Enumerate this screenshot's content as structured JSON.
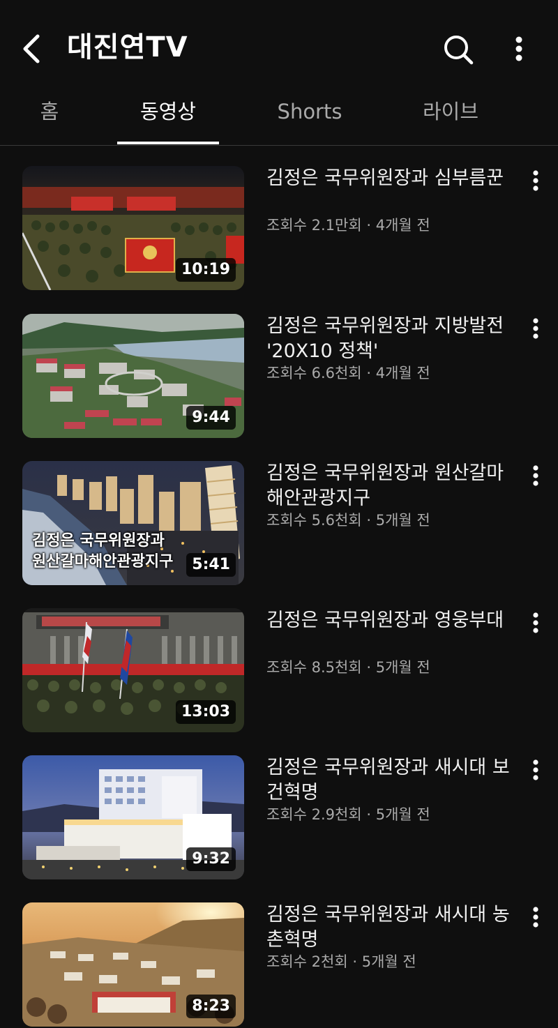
{
  "header": {
    "title": "대진연TV",
    "back_icon": "back-arrow-icon",
    "search_icon": "search-icon",
    "more_icon": "more-vert-icon"
  },
  "tabs": [
    {
      "label": "홈",
      "active": false
    },
    {
      "label": "동영상",
      "active": true
    },
    {
      "label": "Shorts",
      "active": false
    },
    {
      "label": "라이브",
      "active": false
    }
  ],
  "videos": [
    {
      "title": "김정은 국무위원장과 심부름꾼",
      "views": "조회수 2.1만회",
      "age": "4개월 전",
      "duration": "10:19",
      "meta_sep": "·"
    },
    {
      "title": "김정은 국무위원장과 지방발전 '20X10 정책'",
      "views": "조회수 6.6천회",
      "age": "4개월 전",
      "duration": "9:44",
      "meta_sep": "·"
    },
    {
      "title": "김정은 국무위원장과 원산갈마해안관광지구",
      "views": "조회수 5.6천회",
      "age": "5개월 전",
      "duration": "5:41",
      "meta_sep": "·",
      "thumb_caption_1": "김정은 국무위원장과",
      "thumb_caption_2": "원산갈마해안관광지구"
    },
    {
      "title": "김정은 국무위원장과 영웅부대",
      "views": "조회수 8.5천회",
      "age": "5개월 전",
      "duration": "13:03",
      "meta_sep": "·"
    },
    {
      "title": "김정은 국무위원장과 새시대 보건혁명",
      "views": "조회수 2.9천회",
      "age": "5개월 전",
      "duration": "9:32",
      "meta_sep": "·"
    },
    {
      "title": "김정은 국무위원장과 새시대 농촌혁명",
      "views": "조회수 2천회",
      "age": "5개월 전",
      "duration": "8:23",
      "meta_sep": "·"
    }
  ]
}
